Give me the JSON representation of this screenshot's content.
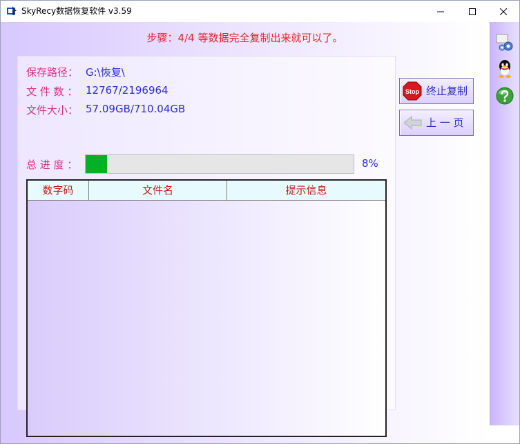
{
  "window": {
    "title": "SkyRecy数据恢复软件 v3.59",
    "controls": {
      "minimize": "minimize-icon",
      "maximize": "maximize-icon",
      "close": "close-icon"
    }
  },
  "step": {
    "text": "步骤：4/4 等数据完全复制出来就可以了。"
  },
  "info": {
    "save_path_label": "保存路径：",
    "save_path_value": "G:\\恢复\\",
    "file_count_label": "文 件 数 ：",
    "file_count_value": "12767/2196964",
    "file_size_label": "文件大小：",
    "file_size_value": "57.09GB/710.04GB",
    "progress_label": "总 进 度 ：",
    "progress_percent": 8,
    "progress_text": "8%"
  },
  "table": {
    "columns": [
      "数字码",
      "文件名",
      "提示信息"
    ],
    "rows": []
  },
  "buttons": {
    "stop_label": "终止复制",
    "stop_icon_text": "Stop",
    "prev_label": "上 一 页"
  },
  "sidebar": {
    "icons": [
      "settings-gears-icon",
      "qq-penguin-icon",
      "help-question-icon"
    ]
  },
  "colors": {
    "step_red": "#e8232a",
    "label_pink": "#d63184",
    "value_blue": "#2a2ed0",
    "progress_green": "#06b025",
    "header_red": "#c91d1d"
  }
}
